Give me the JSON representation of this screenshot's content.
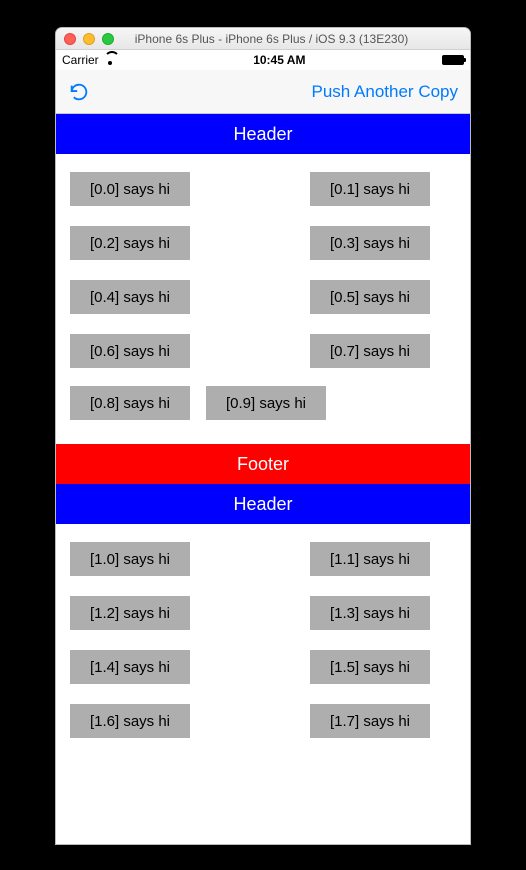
{
  "window": {
    "title": "iPhone 6s Plus - iPhone 6s Plus / iOS 9.3 (13E230)"
  },
  "statusbar": {
    "carrier": "Carrier",
    "time": "10:45 AM"
  },
  "navbar": {
    "push_label": "Push Another Copy"
  },
  "sections": [
    {
      "header": "Header",
      "footer": "Footer",
      "cells": [
        "[0.0] says hi",
        "[0.1] says hi",
        "[0.2] says hi",
        "[0.3] says hi",
        "[0.4] says hi",
        "[0.5] says hi",
        "[0.6] says hi",
        "[0.7] says hi",
        "[0.8] says hi",
        "[0.9] says hi"
      ]
    },
    {
      "header": "Header",
      "cells_visible": [
        "[1.0] says hi",
        "[1.1] says hi",
        "[1.2] says hi",
        "[1.3] says hi",
        "[1.4] says hi",
        "[1.5] says hi",
        "[1.6] says hi",
        "[1.7] says hi"
      ]
    }
  ]
}
